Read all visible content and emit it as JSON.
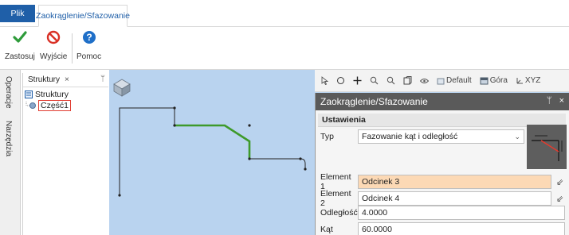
{
  "ribbon": {
    "file_tab": "Plik",
    "active_tab": "Zaokrąglenie/Sfazowanie",
    "commands": {
      "apply": "Zastosuj",
      "exit": "Wyjście",
      "help": "Pomoc"
    }
  },
  "side_tabs": [
    "Operacje",
    "Narzędzia"
  ],
  "tree": {
    "panel_title": "Struktury",
    "close": "×",
    "pin": "ᛘ",
    "root": "Struktury",
    "child": "Część1"
  },
  "toolbar": {
    "default": "Default",
    "view": "Góra",
    "coords": "XYZ"
  },
  "dialog": {
    "title": "Zaokrąglenie/Sfazowanie",
    "pin": "ᛘ",
    "close": "×",
    "section": "Ustawienia",
    "type_label": "Typ",
    "type_value": "Fazowanie kąt i odległość",
    "element1_label": "Element 1",
    "element1_value": "Odcinek 3",
    "element2_label": "Element 2",
    "element2_value": "Odcinek 4",
    "distance_label": "Odległość",
    "distance_value": "4.0000",
    "angle_label": "Kąt",
    "angle_value": "60.0000"
  },
  "colors": {
    "accent": "#1f5fa8",
    "apply_green": "#2e9b3a",
    "exit_red": "#d93025",
    "help_blue": "#1f6fc8",
    "selection_green": "#3e9a2a",
    "canvas": "#b9d3ef",
    "highlight_field": "#fcd9b5"
  }
}
